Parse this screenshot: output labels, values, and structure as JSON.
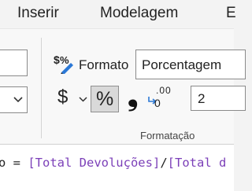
{
  "tabs": [
    {
      "label": "Inserir"
    },
    {
      "label": "Modelagem"
    },
    {
      "label": "E"
    }
  ],
  "formatting": {
    "format_label": "Formato",
    "format_value": "Porcentagem",
    "currency_symbol": "$",
    "percent_symbol": "%",
    "comma_symbol": "❟",
    "decimal_top": ".00",
    "decimal_bottom": "0",
    "decimal_places": "2",
    "group_label": "Formatação"
  },
  "formula": {
    "prefix": "o = ",
    "measure1": "[Total Devoluções]",
    "operator": "/",
    "measure2": "[Total d"
  },
  "colors": {
    "accent_blue": "#2b78d6",
    "measure_purple": "#7b3fb8"
  }
}
